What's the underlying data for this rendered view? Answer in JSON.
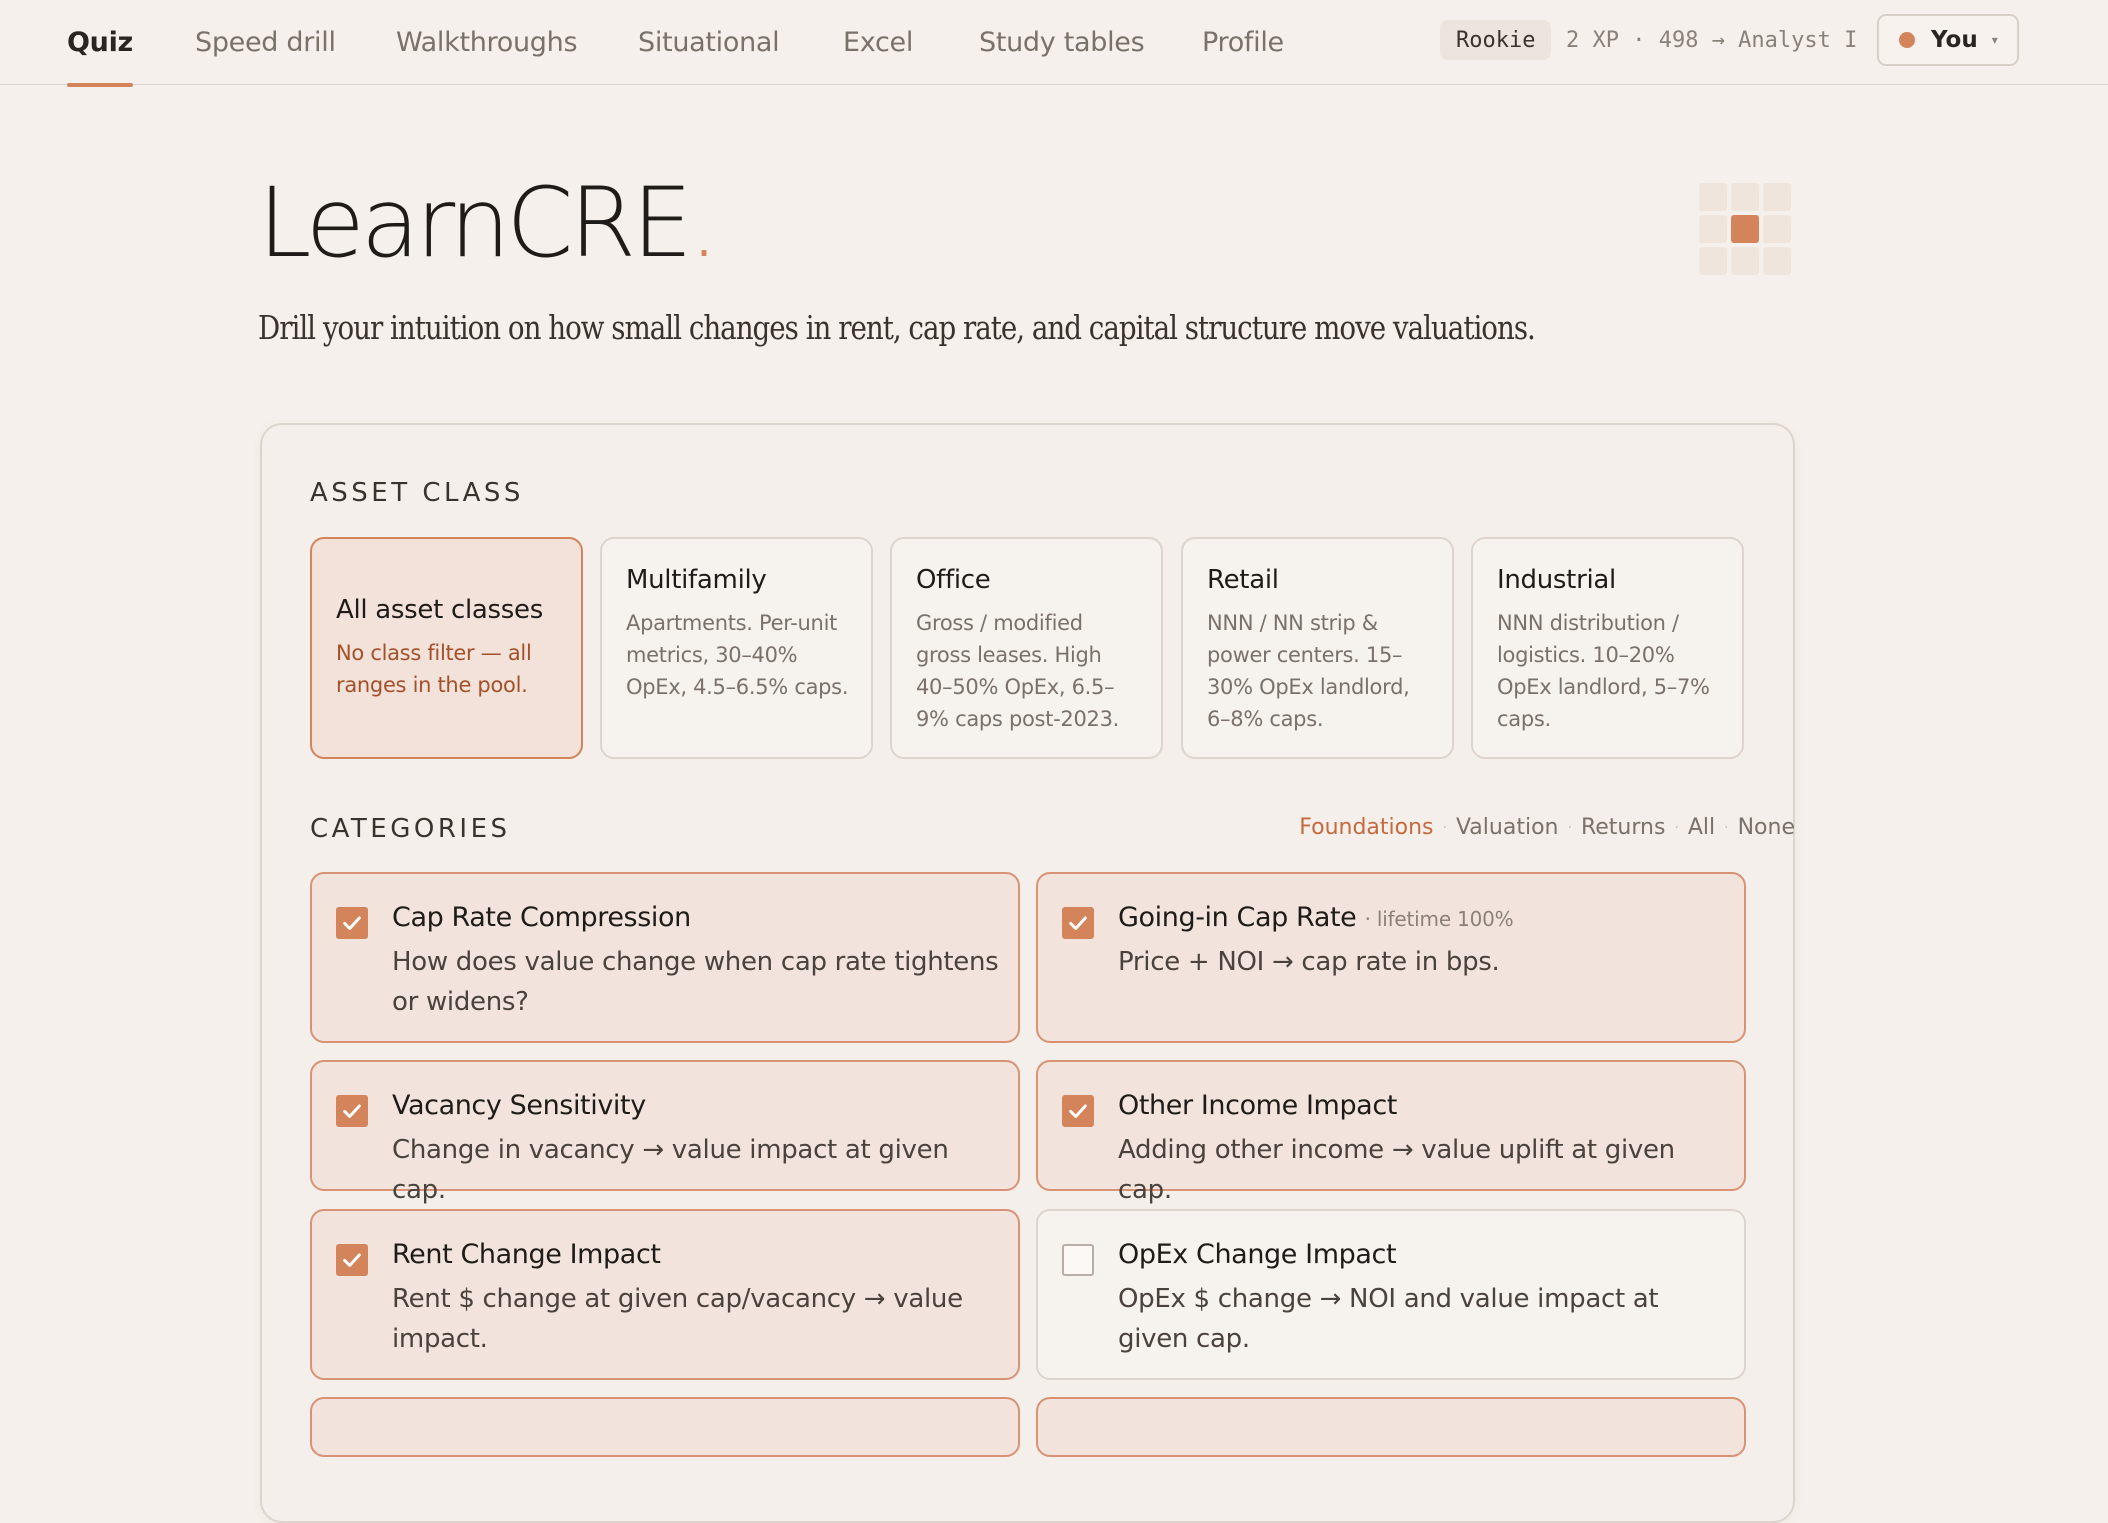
{
  "nav": {
    "tabs": [
      {
        "label": "Quiz",
        "active": true
      },
      {
        "label": "Speed drill"
      },
      {
        "label": "Walkthroughs"
      },
      {
        "label": "Situational"
      },
      {
        "label": "Excel"
      },
      {
        "label": "Study tables"
      },
      {
        "label": "Profile"
      }
    ],
    "rank": "Rookie",
    "xp_progress": "2 XP · 498 → Analyst I",
    "user": {
      "name": "You",
      "caret": "▾"
    }
  },
  "hero": {
    "brand": "LearnCRE",
    "brand_dot": ".",
    "tagline": "Drill your intuition on how small changes in rent, cap rate, and capital structure move valuations."
  },
  "asset_class": {
    "label": "ASSET CLASS",
    "cards": [
      {
        "title": "All asset classes",
        "desc": "No class filter — all ranges in the pool.",
        "selected": true
      },
      {
        "title": "Multifamily",
        "desc": "Apartments. Per-unit metrics, 30–40% OpEx, 4.5–6.5% caps."
      },
      {
        "title": "Office",
        "desc": "Gross / modified gross leases. High 40–50% OpEx, 6.5–9% caps post-2023."
      },
      {
        "title": "Retail",
        "desc": "NNN / NN strip & power centers. 15–30% OpEx landlord, 6–8% caps."
      },
      {
        "title": "Industrial",
        "desc": "NNN distribution / logistics. 10–20% OpEx landlord, 5–7% caps."
      }
    ]
  },
  "categories": {
    "label": "CATEGORIES",
    "filters": [
      {
        "label": "Foundations",
        "active": true
      },
      {
        "label": "Valuation"
      },
      {
        "label": "Returns"
      },
      {
        "label": "All"
      },
      {
        "label": "None"
      }
    ],
    "items": [
      {
        "title": "Cap Rate Compression",
        "note": "",
        "desc": "How does value change when cap rate tightens or widens?",
        "checked": true
      },
      {
        "title": "Going-in Cap Rate",
        "note": "· lifetime 100%",
        "desc": "Price + NOI → cap rate in bps.",
        "checked": true
      },
      {
        "title": "Vacancy Sensitivity",
        "note": "",
        "desc": "Change in vacancy → value impact at given cap.",
        "checked": true
      },
      {
        "title": "Other Income Impact",
        "note": "",
        "desc": "Adding other income → value uplift at given cap.",
        "checked": true
      },
      {
        "title": "Rent Change Impact",
        "note": "",
        "desc": "Rent $ change at given cap/vacancy → value impact.",
        "checked": true
      },
      {
        "title": "OpEx Change Impact",
        "note": "",
        "desc": "OpEx $ change → NOI and value impact at given cap.",
        "checked": false
      }
    ]
  },
  "colors": {
    "accent": "#d4845a",
    "background": "#f5f0eb"
  }
}
